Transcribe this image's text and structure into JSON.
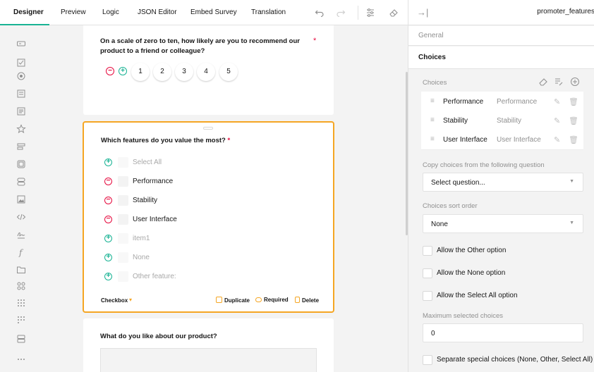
{
  "topbar": {
    "tabs": [
      "Designer",
      "Preview",
      "Logic",
      "JSON Editor",
      "Embed Survey",
      "Translation"
    ],
    "icons": [
      "undo-icon",
      "redo-icon",
      "settings-icon",
      "eraser-icon"
    ]
  },
  "toolbox": {
    "icons": [
      "text-input-icon",
      "checkbox-icon",
      "radiogroup-icon",
      "dropdown-icon",
      "comment-icon",
      "rating-icon",
      "ranking-icon",
      "image-picker-icon",
      "boolean-icon",
      "image-icon",
      "html-icon",
      "signature-icon",
      "expression-icon",
      "file-icon",
      "matrix-icon",
      "matrix-dropdown-icon",
      "matrix-dynamic-icon",
      "panel-icon",
      "more-icon"
    ]
  },
  "questions": {
    "q1": {
      "title": "On a scale of zero to ten, how likely are you to recommend our product to a friend or colleague?",
      "required_mark": "*",
      "rates": [
        "1",
        "2",
        "3",
        "4",
        "5"
      ]
    },
    "q2": {
      "title": "Which features do you value the most?",
      "required_mark": "*",
      "options": [
        {
          "label": "Select All",
          "control": "add",
          "faded": true
        },
        {
          "label": "Performance",
          "control": "remove",
          "faded": false
        },
        {
          "label": "Stability",
          "control": "remove",
          "faded": false
        },
        {
          "label": "User Interface",
          "control": "remove",
          "faded": false
        },
        {
          "label": "item1",
          "control": "add",
          "faded": true
        },
        {
          "label": "None",
          "control": "add",
          "faded": true
        },
        {
          "label": "Other feature:",
          "control": "add",
          "faded": true
        }
      ],
      "type_label": "Checkbox",
      "actions": {
        "duplicate": "Duplicate",
        "required": "Required",
        "delete": "Delete"
      }
    },
    "q3": {
      "title": "What do you like about our product?"
    }
  },
  "panel": {
    "title": "promoter_features",
    "sections": {
      "general": "General",
      "choices": "Choices"
    },
    "choices_label": "Choices",
    "choices": [
      {
        "value": "Performance",
        "text": "Performance"
      },
      {
        "value": "Stability",
        "text": "Stability"
      },
      {
        "value": "User Interface",
        "text": "User Interface"
      }
    ],
    "copy_label": "Copy choices from the following question",
    "copy_value": "Select question...",
    "sort_label": "Choices sort order",
    "sort_value": "None",
    "checks": {
      "other": "Allow the Other option",
      "none": "Allow the None option",
      "select_all": "Allow the Select All option"
    },
    "max_label": "Maximum selected choices",
    "max_value": "0",
    "separate_label": "Separate special choices (None, Other, Select All)"
  },
  "colors": {
    "accent": "#19b394",
    "selection": "#f5a623",
    "danger": "#e60a3e"
  }
}
